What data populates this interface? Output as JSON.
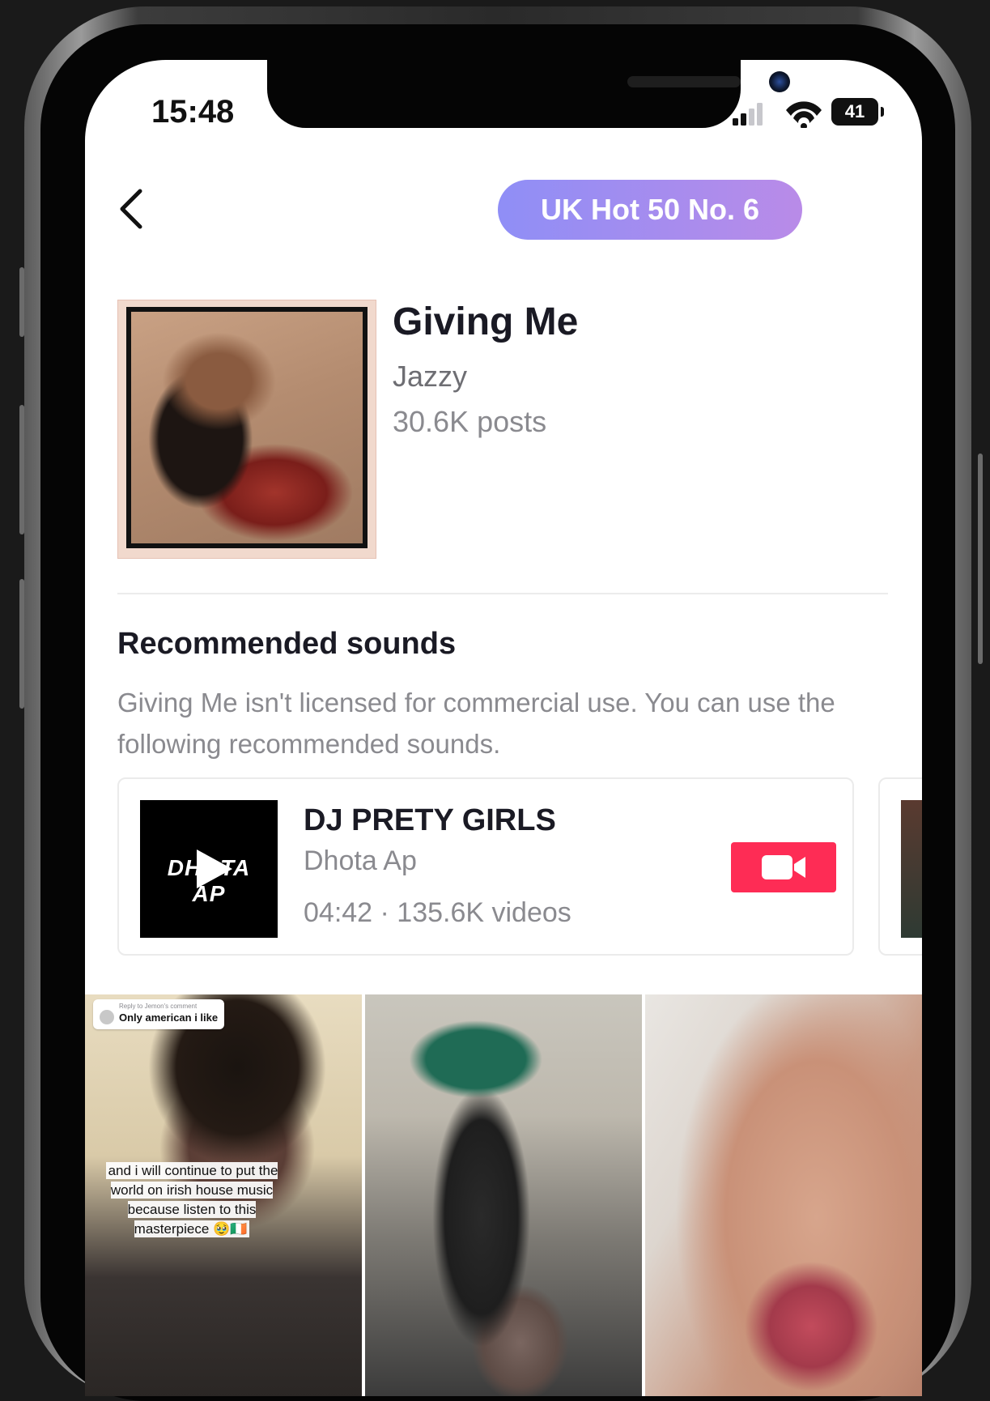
{
  "status_bar": {
    "time": "15:48",
    "battery": "41"
  },
  "header": {
    "chart_badge": "UK Hot 50 No. 6"
  },
  "song": {
    "title": "Giving Me",
    "artist": "Jazzy",
    "posts": "30.6K posts"
  },
  "recommended": {
    "heading": "Recommended sounds",
    "description": "Giving Me isn't licensed for commercial use. You can use the following recommended sounds.",
    "sounds": [
      {
        "title": "DJ PRETY GIRLS",
        "artist": "Dhota Ap",
        "meta": "04:42 · 135.6K videos",
        "thumb_logo": "DHOTA AP"
      }
    ]
  },
  "videos": [
    {
      "comment_reply": "Reply to Jemon's comment",
      "comment": "Only american i like",
      "caption": "and i will continue to put the world on irish house music because listen to this masterpiece 🥹🇮🇪"
    },
    {},
    {}
  ],
  "colors": {
    "badge_gradient_start": "#8f8ef6",
    "badge_gradient_end": "#b98be8",
    "use_sound_button": "#fe2c55",
    "text_primary": "#1a1a24",
    "text_secondary": "#8a8a8f"
  },
  "icons": {
    "back": "chevron-left-icon",
    "use_sound": "video-camera-icon",
    "play": "play-icon"
  }
}
